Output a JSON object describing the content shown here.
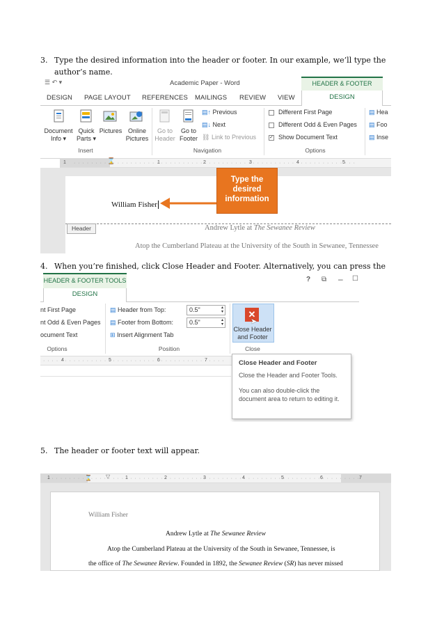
{
  "steps": [
    {
      "num": "3.",
      "text": "Type the desired information into the header or footer. In our example, we’ll type the author’s name."
    },
    {
      "num": "4.",
      "text": "When you’re finished, click Close Header and Footer. Alternatively, you can press the Esc key."
    },
    {
      "num": "5.",
      "text": "The header or footer text will appear."
    }
  ],
  "shot1": {
    "window_title": "Academic Paper - Word",
    "contextual_tab": "HEADER & FOOTER TOOLS",
    "tabs": [
      "DESIGN",
      "PAGE LAYOUT",
      "REFERENCES",
      "MAILINGS",
      "REVIEW",
      "VIEW",
      "DESIGN"
    ],
    "insert_group": {
      "label": "Insert",
      "buttons": [
        {
          "line1": "Document",
          "line2": "Info ▾"
        },
        {
          "line1": "Quick",
          "line2": "Parts ▾"
        },
        {
          "line1": "Pictures",
          "line2": ""
        },
        {
          "line1": "Online",
          "line2": "Pictures"
        }
      ]
    },
    "navigation_group": {
      "label": "Navigation",
      "buttons": [
        {
          "line1": "Go to",
          "line2": "Header"
        },
        {
          "line1": "Go to",
          "line2": "Footer"
        }
      ],
      "items": [
        "Previous",
        "Next",
        "Link to Previous"
      ]
    },
    "options_group": {
      "label": "Options",
      "items": [
        "Different First Page",
        "Different Odd & Even Pages",
        "Show Document Text"
      ],
      "checked": [
        false,
        false,
        true
      ]
    },
    "cut_items": [
      "Hea",
      "Foo",
      "Inse"
    ],
    "ruler_numbers": [
      "1",
      "1",
      "2",
      "3",
      "4",
      "5"
    ],
    "callout": "Type the desired information",
    "header_text": "William Fisher",
    "header_tag": "Header",
    "doc_line1_a": "Andrew Lytle at ",
    "doc_line1_b": "The Sewanee Review",
    "doc_line2": "Atop the Cumberland Plateau at the University of the South in Sewanee, Tennessee"
  },
  "shot2": {
    "contextual_tab": "HEADER & FOOTER TOOLS",
    "tab": "DESIGN",
    "window_controls": [
      "?",
      "⧉",
      "–",
      "☐"
    ],
    "options_items": [
      "nt First Page",
      "nt Odd & Even Pages",
      "ocument Text"
    ],
    "options_label": "Options",
    "position_items": [
      {
        "label": "Header from Top:",
        "value": "0.5\""
      },
      {
        "label": "Footer from Bottom:",
        "value": "0.5\""
      }
    ],
    "insert_alignment_tab": "Insert Alignment Tab",
    "position_label": "Position",
    "close_button": {
      "line1": "Close Header",
      "line2": "and Footer"
    },
    "close_label": "Close",
    "ruler_numbers": [
      "4",
      "5",
      "6",
      "7"
    ],
    "tooltip": {
      "title": "Close Header and Footer",
      "line1": "Close the Header and Footer Tools.",
      "line2": "You can also double-click the document area to return to editing it."
    }
  },
  "shot3": {
    "ruler_numbers": [
      "1",
      "1",
      "2",
      "3",
      "4",
      "5",
      "6",
      "7"
    ],
    "header_text": "William Fisher",
    "title_a": "Andrew Lytle at ",
    "title_b": "The Sewanee Review",
    "line1": "Atop the Cumberland Plateau at the University of the South in Sewanee, Tennessee, is",
    "line2_a": "the office of ",
    "line2_b": "The Sewanee Review",
    "line2_c": ". Founded in 1892, the ",
    "line2_d": "Sewanee Review",
    "line2_e": " (",
    "line2_f": "SR",
    "line2_g": ") has never missed"
  },
  "colors": {
    "accent_green": "#217346",
    "callout_orange": "#e8751f",
    "close_red": "#d9472b",
    "tab_green_bg": "#e9f3e6"
  }
}
